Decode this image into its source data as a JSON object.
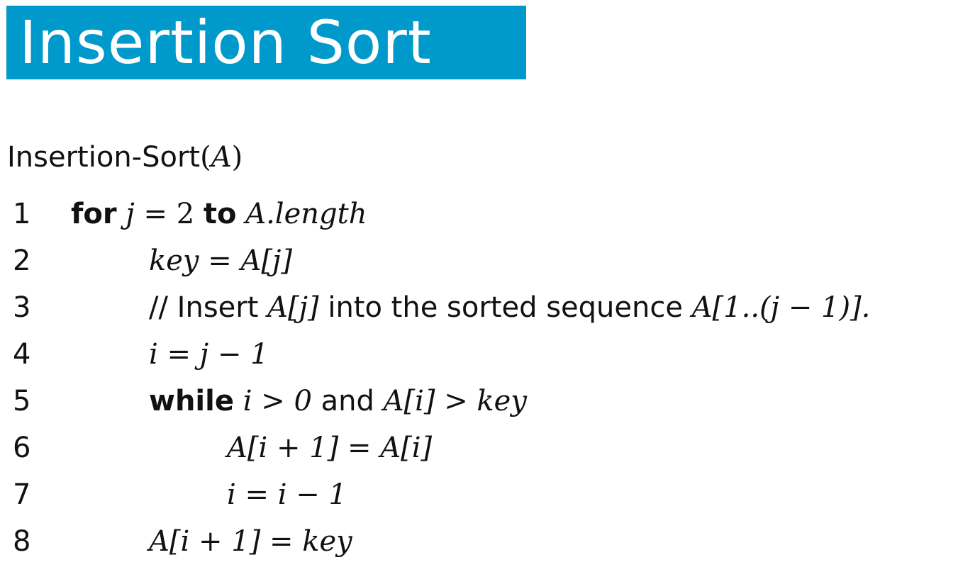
{
  "title": "Insertion Sort",
  "procedure": {
    "name": "Insertion-Sort",
    "param": "A"
  },
  "lines": [
    {
      "number": "1",
      "kw1": "for",
      "var": "j",
      "op": "=",
      "start": "2",
      "kw2": "to",
      "target": "A.length"
    },
    {
      "number": "2",
      "lhs": "key",
      "op": "=",
      "rhs": "A[j]"
    },
    {
      "number": "3",
      "comment_prefix": "// Insert",
      "expr1": "A[j]",
      "text": "into the sorted sequence",
      "expr2": "A[1..(j − 1)]."
    },
    {
      "number": "4",
      "lhs": "i",
      "op": "=",
      "rhs": "j − 1"
    },
    {
      "number": "5",
      "kw": "while",
      "cond1": "i > 0",
      "and": "and",
      "cond2": "A[i] > key"
    },
    {
      "number": "6",
      "lhs": "A[i + 1]",
      "op": "=",
      "rhs": "A[i]"
    },
    {
      "number": "7",
      "lhs": "i",
      "op": "=",
      "rhs": "i − 1"
    },
    {
      "number": "8",
      "lhs": "A[i + 1]",
      "op": "=",
      "rhs": "key"
    }
  ],
  "colors": {
    "title_background": "#0099cc",
    "title_text": "#ffffff"
  }
}
